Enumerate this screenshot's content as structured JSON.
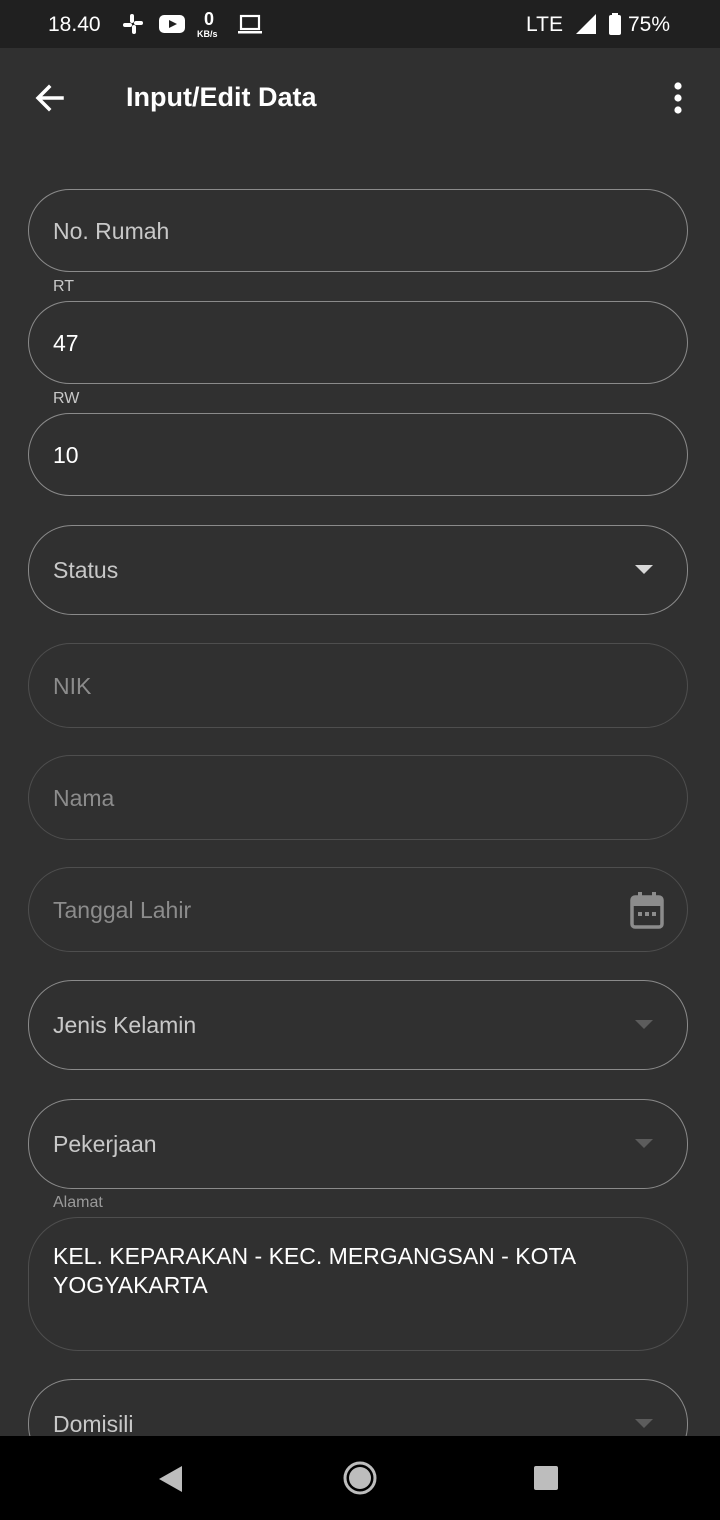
{
  "status_bar": {
    "time": "18.40",
    "network_speed_value": "0",
    "network_speed_unit": "KB/s",
    "network_type": "LTE",
    "battery": "75%",
    "icons": [
      "slack-icon",
      "youtube-icon",
      "laptop-icon",
      "signal-icon",
      "battery-icon"
    ]
  },
  "app_bar": {
    "title": "Input/Edit Data",
    "icons": [
      "back-arrow-icon",
      "more-vert-icon"
    ]
  },
  "form": {
    "no_rumah": {
      "placeholder": "No. Rumah"
    },
    "rt": {
      "label": "RT",
      "value": "47"
    },
    "rw": {
      "label": "RW",
      "value": "10"
    },
    "status": {
      "placeholder": "Status"
    },
    "nik": {
      "placeholder": "NIK"
    },
    "nama": {
      "placeholder": "Nama"
    },
    "tanggal_lahir": {
      "placeholder": "Tanggal Lahir",
      "icon": "calendar-icon"
    },
    "jenis_kelamin": {
      "placeholder": "Jenis Kelamin"
    },
    "pekerjaan": {
      "placeholder": "Pekerjaan"
    },
    "alamat": {
      "label": "Alamat",
      "value_line1": "KEL. KEPARAKAN - KEC. MERGANGSAN - KOTA",
      "value_line2": "YOGYAKARTA"
    },
    "domisili": {
      "placeholder": "Domisili"
    }
  },
  "nav_bar": {
    "icons": [
      "nav-back-icon",
      "nav-home-icon",
      "nav-recents-icon"
    ]
  },
  "colors": {
    "background": "#303030",
    "status_bar": "#202020",
    "nav_bar": "#000000",
    "outline": "#8a8a8a"
  }
}
